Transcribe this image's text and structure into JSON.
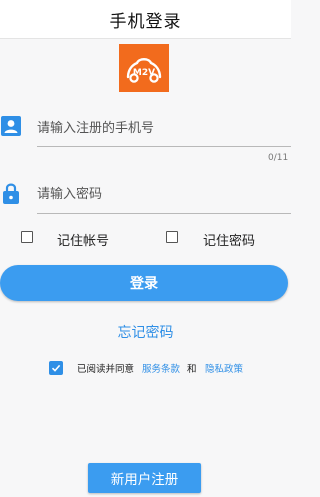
{
  "header": {
    "title": "手机登录"
  },
  "logo": {
    "text": "M2V",
    "color": "#f26b1d"
  },
  "phone_field": {
    "placeholder": "请输入注册的手机号",
    "value": "",
    "counter": "0/11",
    "icon": "user-card-icon"
  },
  "password_field": {
    "placeholder": "请输入密码",
    "value": "",
    "icon": "lock-icon"
  },
  "remember_account": {
    "label": "记住帐号",
    "checked": false
  },
  "remember_password": {
    "label": "记住密码",
    "checked": false
  },
  "login_button": {
    "label": "登录"
  },
  "forgot_link": {
    "label": "忘记密码"
  },
  "agreement": {
    "checked": true,
    "prefix": "已阅读并同意",
    "terms_link": "服务条款",
    "conjunction": "和",
    "privacy_link": "隐私政策"
  },
  "register_button": {
    "label": "新用户注册"
  },
  "colors": {
    "accent": "#3b9cf0",
    "link": "#2f8fe6",
    "logo_bg": "#f26b1d"
  }
}
